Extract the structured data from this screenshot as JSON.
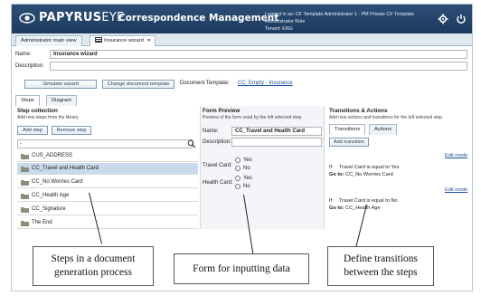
{
  "header": {
    "brand_bold": "PAPYRUS",
    "brand_light": "EYE",
    "app_title": "Correspondence Management",
    "login_line1": "Logged in as: CF Template Administrator 1 · PM Private CF Template Administrator Role",
    "login_line2": "Tenant: ENG",
    "icons": [
      "papyrus-logo-icon",
      "settings-icon",
      "power-icon"
    ]
  },
  "tabs": [
    {
      "label": "Administrator main view"
    },
    {
      "label": "Insurance wizard",
      "close": "×"
    }
  ],
  "form": {
    "name_label": "Name:",
    "name_value": "Insurance wizard",
    "description_label": "Description:",
    "description_value": ""
  },
  "toolbar": {
    "simulate_label": "Simulate wizard",
    "change_template_label": "Change document template",
    "doc_template_label": "Document Template:",
    "doc_template_link": "CC_Empty - Insurance"
  },
  "subtabs": [
    "Steps",
    "Diagram"
  ],
  "steps_panel": {
    "title": "Step collection",
    "subtitle": "Add new steps from the library.",
    "add_label": "Add step",
    "remove_label": "Remove step",
    "search_value": "-",
    "items": [
      "CUS_ADDRESS",
      "CC_Travel and Health Card",
      "CC_No Worries Card",
      "CC_Health Age",
      "CC_Signature",
      "The End"
    ]
  },
  "form_panel": {
    "title": "Form Preview",
    "subtitle": "Preview of the form used by the left selected step.",
    "name_label": "Name:",
    "name_value": "CC_Travel and Health Card",
    "description_label": "Description:",
    "travel_label": "Travel Card:",
    "health_label": "Health Card:",
    "yes": "Yes",
    "no": "No"
  },
  "trans_panel": {
    "title": "Transitions & Actions",
    "subtitle": "Add new actions and transitions for the left selected step.",
    "tabs": [
      "Transitions",
      "Actions"
    ],
    "add_label": "Add transition",
    "edit_mode": "Edit mode",
    "t1_if_label": "If:",
    "t1_if": "Travel Card is equal to Yes",
    "t1_goto_label": "Go to:",
    "t1_goto": "CC_No Worries Card",
    "t2_if_label": "If:",
    "t2_if": "Travel Card is equal to No",
    "t2_goto_label": "Go to:",
    "t2_goto": "CC_Health Age"
  },
  "callouts": {
    "steps_line1": "Steps in a document",
    "steps_line2": "generation process",
    "form": "Form for inputting data",
    "trans_line1": "Define transitions",
    "trans_line2": "between the steps"
  },
  "colors": {
    "header": "#1f3d62",
    "selected_row": "#c9daec",
    "link": "#1a4f9c"
  }
}
